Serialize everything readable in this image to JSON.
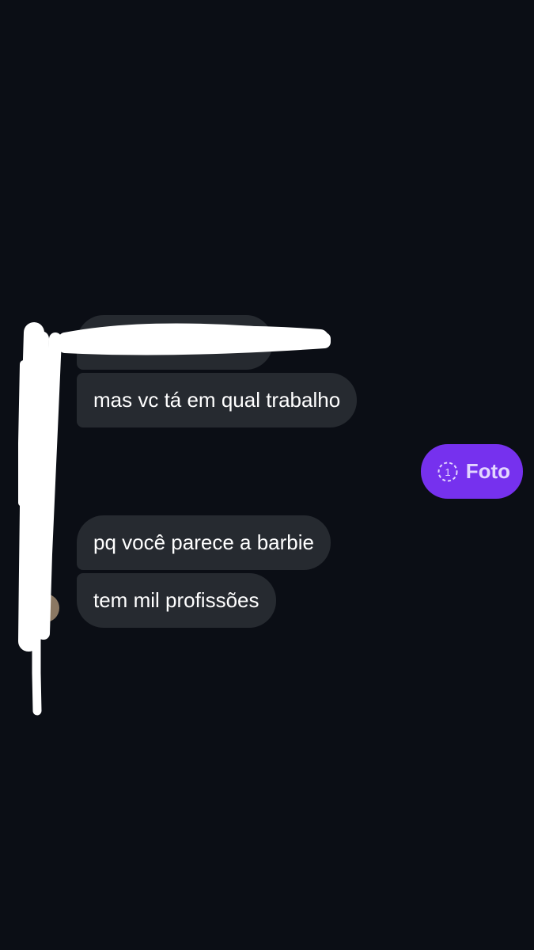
{
  "messages": [
    {
      "from": "contact",
      "text": ""
    },
    {
      "from": "contact",
      "text": "mas vc tá em qual trabalho"
    },
    {
      "from": "me",
      "type": "view-once-photo",
      "count": "1",
      "label": "Foto"
    },
    {
      "from": "contact",
      "text": "pq você parece a barbie"
    },
    {
      "from": "contact",
      "text": "tem mil profissões"
    }
  ],
  "colors": {
    "background": "#0b0e15",
    "incoming_bubble": "#262a30",
    "outgoing_bubble": "#7631ee",
    "redaction": "#ffffff"
  }
}
